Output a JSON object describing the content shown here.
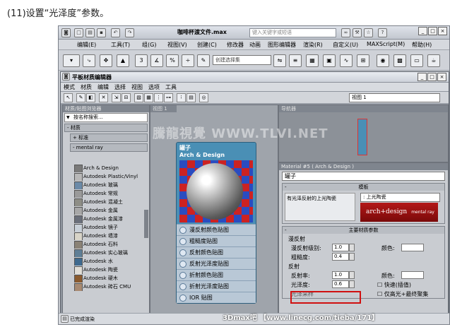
{
  "caption": "(11)设置“光泽度”参数。",
  "app": {
    "title": "咖啡杯渡文件.max",
    "search_placeholder": "键入关键字或短语",
    "menu": [
      "编辑(E)",
      "工具(T)",
      "组(G)",
      "视图(V)",
      "创建(C)",
      "修改器",
      "动画",
      "图形编辑器",
      "渲染(R)",
      "自定义(U)",
      "MAXScript(M)",
      "帮助(H)"
    ],
    "selection_set_placeholder": "创建选择集",
    "status_text": "已完成渲染"
  },
  "editor": {
    "title": "平板材质编辑器",
    "menu": [
      "模式",
      "材质",
      "编辑",
      "选择",
      "视图",
      "选项",
      "工具"
    ],
    "view_select": "视图 1",
    "browser": {
      "header": "材质/贴图浏览器",
      "search_placeholder": "按名称搜索...",
      "group_materials": "- 材质",
      "group_standard": "+ 标准",
      "group_mentalray": "- mental ray",
      "materials": [
        {
          "name": "Arch & Design",
          "color": "#7a7a7a"
        },
        {
          "name": "Autodesk Plastic/Vinyl",
          "color": "#b8b8b8"
        },
        {
          "name": "Autodesk 玻璃",
          "color": "#6b8aa8"
        },
        {
          "name": "Autodesk 常规",
          "color": "#9a9a9a"
        },
        {
          "name": "Autodesk 混凝土",
          "color": "#8e8e86"
        },
        {
          "name": "Autodesk 金属",
          "color": "#a8a8a8"
        },
        {
          "name": "Autodesk 金属漆",
          "color": "#6a6f7a"
        },
        {
          "name": "Autodesk 镜子",
          "color": "#c8d0d8"
        },
        {
          "name": "Autodesk 墙漆",
          "color": "#d8d4c8"
        },
        {
          "name": "Autodesk 石料",
          "color": "#8a8276"
        },
        {
          "name": "Autodesk 实心玻璃",
          "color": "#5f7f96"
        },
        {
          "name": "Autodesk 水",
          "color": "#3f6a8e"
        },
        {
          "name": "Autodesk 陶瓷",
          "color": "#e0ddd6"
        },
        {
          "name": "Autodesk 硬木",
          "color": "#8a5a2e"
        },
        {
          "name": "Autodesk 砖石 CMU",
          "color": "#a88a72"
        }
      ]
    },
    "view_tab": "视图 1",
    "node": {
      "title": "罐子",
      "subtitle": "Arch & Design",
      "slots": [
        "漫反射颜色贴图",
        "粗糙度贴图",
        "反射颜色贴图",
        "反射光泽度贴图",
        "折射颜色贴图",
        "折射光泽度贴图",
        "IOR 贴图"
      ]
    },
    "navigator_header": "导航器",
    "props_header": "Material #5 ( Arch & Design )",
    "material_name": "罐子",
    "template_label": "模板",
    "template_desc": "有光泽反射的上光陶瓷",
    "template_pick": ": 上光陶瓷",
    "logo_text": "arch+design",
    "logo_sub": "mental ray",
    "main_params_label": "主要材质参数",
    "diffuse_label": "漫反射",
    "diffuse_level_label": "漫反射级别:",
    "diffuse_level": "1.0",
    "roughness_label": "粗糙度:",
    "roughness": "0.4",
    "color_label": "颜色:",
    "reflection_label": "反射",
    "reflectivity_label": "反射率:",
    "reflectivity": "1.0",
    "glossiness_label": "光泽度:",
    "glossiness": "0.6",
    "fast_interp_label": "快速(插值)",
    "highlights_only_label": "仅高光+最终聚集",
    "gloss_samples_label": "光泽采样"
  },
  "watermark": "騰龍視覺 WWW.TLVI.NET",
  "footer": "3Dmax吧 【www.linecg.com/tieba/171】"
}
